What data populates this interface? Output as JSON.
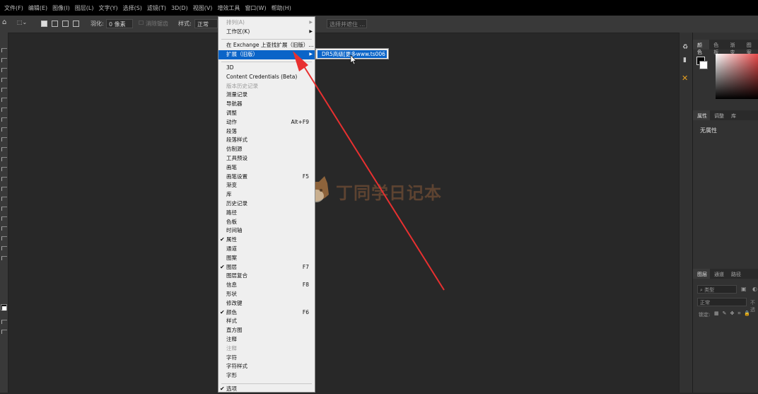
{
  "menubar": [
    "文件(F)",
    "编辑(E)",
    "图像(I)",
    "图层(L)",
    "文字(Y)",
    "选择(S)",
    "滤镜(T)",
    "3D(D)",
    "视图(V)",
    "增效工具",
    "窗口(W)",
    "帮助(H)"
  ],
  "options": {
    "feather_label": "羽化:",
    "feather_value": "0 像素",
    "antialias": "消除锯齿",
    "style_label": "样式:",
    "style_value": "正常",
    "select_mask": "选择并遮住 ..."
  },
  "window_menu": {
    "arrange": "排列(A)",
    "workspace": "工作区(K)",
    "exchange": "在 Exchange 上查找扩展（旧版）...",
    "extensions": "扩展（旧版）",
    "items": [
      {
        "label": "3D",
        "shortcut": "",
        "checked": false,
        "disabled": false
      },
      {
        "label": "Content Credentials (Beta)",
        "shortcut": "",
        "checked": false,
        "disabled": false
      },
      {
        "label": "版本历史记录",
        "shortcut": "",
        "checked": false,
        "disabled": true
      },
      {
        "label": "测量记录",
        "shortcut": "",
        "checked": false,
        "disabled": false
      },
      {
        "label": "导航器",
        "shortcut": "",
        "checked": false,
        "disabled": false
      },
      {
        "label": "调整",
        "shortcut": "",
        "checked": false,
        "disabled": false
      },
      {
        "label": "动作",
        "shortcut": "Alt+F9",
        "checked": false,
        "disabled": false
      },
      {
        "label": "段落",
        "shortcut": "",
        "checked": false,
        "disabled": false
      },
      {
        "label": "段落样式",
        "shortcut": "",
        "checked": false,
        "disabled": false
      },
      {
        "label": "仿制源",
        "shortcut": "",
        "checked": false,
        "disabled": false
      },
      {
        "label": "工具预设",
        "shortcut": "",
        "checked": false,
        "disabled": false
      },
      {
        "label": "画笔",
        "shortcut": "",
        "checked": false,
        "disabled": false
      },
      {
        "label": "画笔设置",
        "shortcut": "F5",
        "checked": false,
        "disabled": false
      },
      {
        "label": "渐变",
        "shortcut": "",
        "checked": false,
        "disabled": false
      },
      {
        "label": "库",
        "shortcut": "",
        "checked": false,
        "disabled": false
      },
      {
        "label": "历史记录",
        "shortcut": "",
        "checked": false,
        "disabled": false
      },
      {
        "label": "路径",
        "shortcut": "",
        "checked": false,
        "disabled": false
      },
      {
        "label": "色板",
        "shortcut": "",
        "checked": false,
        "disabled": false
      },
      {
        "label": "时间轴",
        "shortcut": "",
        "checked": false,
        "disabled": false
      },
      {
        "label": "属性",
        "shortcut": "",
        "checked": true,
        "disabled": false
      },
      {
        "label": "通道",
        "shortcut": "",
        "checked": false,
        "disabled": false
      },
      {
        "label": "图案",
        "shortcut": "",
        "checked": false,
        "disabled": false
      },
      {
        "label": "图层",
        "shortcut": "F7",
        "checked": true,
        "disabled": false
      },
      {
        "label": "图层复合",
        "shortcut": "",
        "checked": false,
        "disabled": false
      },
      {
        "label": "信息",
        "shortcut": "F8",
        "checked": false,
        "disabled": false
      },
      {
        "label": "形状",
        "shortcut": "",
        "checked": false,
        "disabled": false
      },
      {
        "label": "修改键",
        "shortcut": "",
        "checked": false,
        "disabled": false
      },
      {
        "label": "颜色",
        "shortcut": "F6",
        "checked": true,
        "disabled": false
      },
      {
        "label": "样式",
        "shortcut": "",
        "checked": false,
        "disabled": false
      },
      {
        "label": "直方图",
        "shortcut": "",
        "checked": false,
        "disabled": false
      },
      {
        "label": "注释",
        "shortcut": "",
        "checked": false,
        "disabled": false
      },
      {
        "label": "注释",
        "shortcut": "",
        "checked": false,
        "disabled": true
      },
      {
        "label": "字符",
        "shortcut": "",
        "checked": false,
        "disabled": false
      },
      {
        "label": "字符样式",
        "shortcut": "",
        "checked": false,
        "disabled": false
      },
      {
        "label": "字形",
        "shortcut": "",
        "checked": false,
        "disabled": false
      }
    ],
    "options_item": "选项"
  },
  "submenu": {
    "item": "DR5高级[更多www.ts006"
  },
  "panels": {
    "color_tabs": [
      "颜色",
      "色板",
      "渐变",
      "图案"
    ],
    "prop_tabs": [
      "属性",
      "调整",
      "库"
    ],
    "no_props": "无属性",
    "layer_tabs": [
      "图层",
      "通道",
      "路径"
    ],
    "layer_filter": "类型",
    "blend_mode": "正常",
    "opacity_label": "不透",
    "lock_label": "锁定:"
  },
  "watermark": "丁同学日记本",
  "colors": {
    "highlight": "#0a64c8",
    "arrow": "#e83030",
    "menu_bg": "#efefef",
    "canvas": "#282828"
  }
}
